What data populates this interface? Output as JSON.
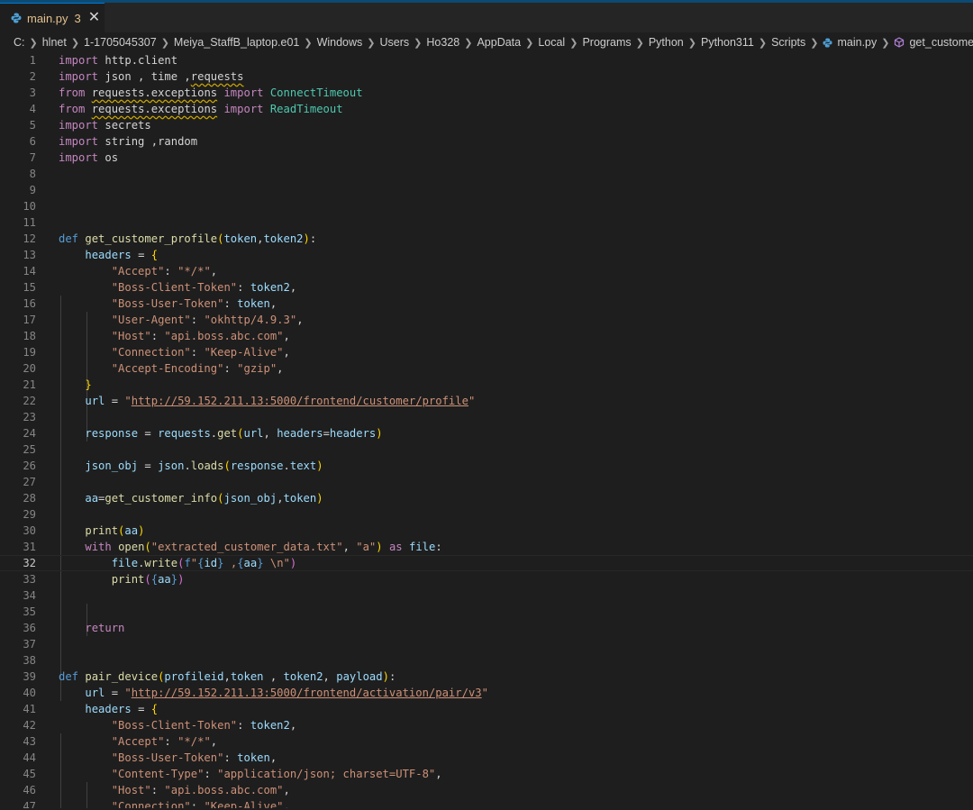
{
  "tab": {
    "filename": "main.py",
    "problems": "3",
    "close": "✕",
    "icon": "python-file-icon"
  },
  "breadcrumb": [
    "C:",
    "hlnet",
    "1-1705045307",
    "Meiya_StaffB_laptop.e01",
    "Windows",
    "Users",
    "Ho328",
    "AppData",
    "Local",
    "Programs",
    "Python",
    "Python311",
    "Scripts"
  ],
  "breadcrumb_file": "main.py",
  "breadcrumb_symbol": "get_customer_profile",
  "colors": {
    "keyword": "#569cd6",
    "control": "#c586c0",
    "function": "#dcdcaa",
    "variable": "#9cdcfe",
    "string": "#ce9178",
    "class": "#4ec9b0",
    "bracket": "#ffd700",
    "warning": "#cca700"
  },
  "editor": {
    "current_line": 32,
    "lines": [
      {
        "n": "1",
        "tokens": [
          [
            "ctl",
            "import"
          ],
          [
            "t",
            " http.client"
          ]
        ]
      },
      {
        "n": "2",
        "tokens": [
          [
            "ctl",
            "import"
          ],
          [
            "t",
            " json , time ,"
          ],
          [
            "sq",
            "requests"
          ]
        ]
      },
      {
        "n": "3",
        "tokens": [
          [
            "ctl",
            "from"
          ],
          [
            "t",
            " "
          ],
          [
            "sq",
            "requests.exceptions"
          ],
          [
            "t",
            " "
          ],
          [
            "ctl",
            "import"
          ],
          [
            "t",
            " "
          ],
          [
            "cls",
            "ConnectTimeout"
          ]
        ]
      },
      {
        "n": "4",
        "tokens": [
          [
            "ctl",
            "from"
          ],
          [
            "t",
            " "
          ],
          [
            "sq",
            "requests.exceptions"
          ],
          [
            "t",
            " "
          ],
          [
            "ctl",
            "import"
          ],
          [
            "t",
            " "
          ],
          [
            "cls",
            "ReadTimeout"
          ]
        ]
      },
      {
        "n": "5",
        "tokens": [
          [
            "ctl",
            "import"
          ],
          [
            "t",
            " secrets"
          ]
        ]
      },
      {
        "n": "6",
        "tokens": [
          [
            "ctl",
            "import"
          ],
          [
            "t",
            " string ,random"
          ]
        ]
      },
      {
        "n": "7",
        "tokens": [
          [
            "ctl",
            "import"
          ],
          [
            "t",
            " os"
          ]
        ]
      },
      {
        "n": "8",
        "tokens": []
      },
      {
        "n": "9",
        "tokens": []
      },
      {
        "n": "10",
        "tokens": []
      },
      {
        "n": "11",
        "tokens": []
      },
      {
        "n": "12",
        "tokens": [
          [
            "kw",
            "def"
          ],
          [
            "t",
            " "
          ],
          [
            "fn",
            "get_customer_profile"
          ],
          [
            "br",
            "("
          ],
          [
            "par",
            "token"
          ],
          [
            "t",
            ","
          ],
          [
            "par",
            "token2"
          ],
          [
            "br",
            ")"
          ],
          [
            "t",
            ":"
          ]
        ]
      },
      {
        "n": "13",
        "tokens": [
          [
            "t",
            "    "
          ],
          [
            "var",
            "headers"
          ],
          [
            "t",
            " = "
          ],
          [
            "br",
            "{"
          ]
        ]
      },
      {
        "n": "14",
        "tokens": [
          [
            "t",
            "        "
          ],
          [
            "str",
            "\"Accept\""
          ],
          [
            "t",
            ": "
          ],
          [
            "str",
            "\"*/*\""
          ],
          [
            "t",
            ","
          ]
        ]
      },
      {
        "n": "15",
        "tokens": [
          [
            "t",
            "        "
          ],
          [
            "str",
            "\"Boss-Client-Token\""
          ],
          [
            "t",
            ": "
          ],
          [
            "var",
            "token2"
          ],
          [
            "t",
            ","
          ]
        ]
      },
      {
        "n": "16",
        "tokens": [
          [
            "t",
            "        "
          ],
          [
            "str",
            "\"Boss-User-Token\""
          ],
          [
            "t",
            ": "
          ],
          [
            "var",
            "token"
          ],
          [
            "t",
            ","
          ]
        ]
      },
      {
        "n": "17",
        "tokens": [
          [
            "t",
            "        "
          ],
          [
            "str",
            "\"User-Agent\""
          ],
          [
            "t",
            ": "
          ],
          [
            "str",
            "\"okhttp/4.9.3\""
          ],
          [
            "t",
            ","
          ]
        ]
      },
      {
        "n": "18",
        "tokens": [
          [
            "t",
            "        "
          ],
          [
            "str",
            "\"Host\""
          ],
          [
            "t",
            ": "
          ],
          [
            "str",
            "\"api.boss.abc.com\""
          ],
          [
            "t",
            ","
          ]
        ]
      },
      {
        "n": "19",
        "tokens": [
          [
            "t",
            "        "
          ],
          [
            "str",
            "\"Connection\""
          ],
          [
            "t",
            ": "
          ],
          [
            "str",
            "\"Keep-Alive\""
          ],
          [
            "t",
            ","
          ]
        ]
      },
      {
        "n": "20",
        "tokens": [
          [
            "t",
            "        "
          ],
          [
            "str",
            "\"Accept-Encoding\""
          ],
          [
            "t",
            ": "
          ],
          [
            "str",
            "\"gzip\""
          ],
          [
            "t",
            ","
          ]
        ]
      },
      {
        "n": "21",
        "tokens": [
          [
            "t",
            "    "
          ],
          [
            "br",
            "}"
          ]
        ]
      },
      {
        "n": "22",
        "tokens": [
          [
            "t",
            "    "
          ],
          [
            "var",
            "url"
          ],
          [
            "t",
            " = "
          ],
          [
            "str",
            "\""
          ],
          [
            "surl",
            "http://59.152.211.13:5000/frontend/customer/profile"
          ],
          [
            "str",
            "\""
          ]
        ]
      },
      {
        "n": "23",
        "tokens": []
      },
      {
        "n": "24",
        "tokens": [
          [
            "t",
            "    "
          ],
          [
            "var",
            "response"
          ],
          [
            "t",
            " = "
          ],
          [
            "var",
            "requests"
          ],
          [
            "t",
            "."
          ],
          [
            "fn",
            "get"
          ],
          [
            "br",
            "("
          ],
          [
            "var",
            "url"
          ],
          [
            "t",
            ", "
          ],
          [
            "par",
            "headers"
          ],
          [
            "t",
            "="
          ],
          [
            "var",
            "headers"
          ],
          [
            "br",
            ")"
          ]
        ]
      },
      {
        "n": "25",
        "tokens": []
      },
      {
        "n": "26",
        "tokens": [
          [
            "t",
            "    "
          ],
          [
            "var",
            "json_obj"
          ],
          [
            "t",
            " = "
          ],
          [
            "var",
            "json"
          ],
          [
            "t",
            "."
          ],
          [
            "fn",
            "loads"
          ],
          [
            "br",
            "("
          ],
          [
            "var",
            "response"
          ],
          [
            "t",
            "."
          ],
          [
            "var",
            "text"
          ],
          [
            "br",
            ")"
          ]
        ]
      },
      {
        "n": "27",
        "tokens": []
      },
      {
        "n": "28",
        "tokens": [
          [
            "t",
            "    "
          ],
          [
            "var",
            "aa"
          ],
          [
            "t",
            "="
          ],
          [
            "fn",
            "get_customer_info"
          ],
          [
            "br",
            "("
          ],
          [
            "var",
            "json_obj"
          ],
          [
            "t",
            ","
          ],
          [
            "var",
            "token"
          ],
          [
            "br",
            ")"
          ]
        ]
      },
      {
        "n": "29",
        "tokens": []
      },
      {
        "n": "30",
        "tokens": [
          [
            "t",
            "    "
          ],
          [
            "fn",
            "print"
          ],
          [
            "br",
            "("
          ],
          [
            "var",
            "aa"
          ],
          [
            "br",
            ")"
          ]
        ]
      },
      {
        "n": "31",
        "tokens": [
          [
            "t",
            "    "
          ],
          [
            "ctl",
            "with"
          ],
          [
            "t",
            " "
          ],
          [
            "fn",
            "open"
          ],
          [
            "br",
            "("
          ],
          [
            "str",
            "\"extracted_customer_data.txt\""
          ],
          [
            "t",
            ", "
          ],
          [
            "str",
            "\"a\""
          ],
          [
            "br",
            ")"
          ],
          [
            "t",
            " "
          ],
          [
            "ctl",
            "as"
          ],
          [
            "t",
            " "
          ],
          [
            "var",
            "file"
          ],
          [
            "t",
            ":"
          ]
        ]
      },
      {
        "n": "32",
        "tokens": [
          [
            "t",
            "        "
          ],
          [
            "var",
            "file"
          ],
          [
            "t",
            "."
          ],
          [
            "fn",
            "write"
          ],
          [
            "br2",
            "("
          ],
          [
            "kw",
            "f"
          ],
          [
            "str",
            "\""
          ],
          [
            "kw",
            "{"
          ],
          [
            "var",
            "id"
          ],
          [
            "kw",
            "}"
          ],
          [
            "str",
            " ,"
          ],
          [
            "kw",
            "{"
          ],
          [
            "var",
            "aa"
          ],
          [
            "kw",
            "}"
          ],
          [
            "str",
            " \\n\""
          ],
          [
            "br2",
            ")"
          ]
        ]
      },
      {
        "n": "33",
        "tokens": [
          [
            "t",
            "        "
          ],
          [
            "fn",
            "print"
          ],
          [
            "br2",
            "("
          ],
          [
            "kw",
            "{"
          ],
          [
            "var",
            "aa"
          ],
          [
            "kw",
            "}"
          ],
          [
            "br2",
            ")"
          ]
        ]
      },
      {
        "n": "34",
        "tokens": []
      },
      {
        "n": "35",
        "tokens": []
      },
      {
        "n": "36",
        "tokens": [
          [
            "t",
            "    "
          ],
          [
            "ctl",
            "return"
          ]
        ]
      },
      {
        "n": "37",
        "tokens": []
      },
      {
        "n": "38",
        "tokens": []
      },
      {
        "n": "39",
        "tokens": [
          [
            "kw",
            "def"
          ],
          [
            "t",
            " "
          ],
          [
            "fn",
            "pair_device"
          ],
          [
            "br",
            "("
          ],
          [
            "par",
            "profileid"
          ],
          [
            "t",
            ","
          ],
          [
            "par",
            "token"
          ],
          [
            "t",
            " , "
          ],
          [
            "par",
            "token2"
          ],
          [
            "t",
            ", "
          ],
          [
            "par",
            "payload"
          ],
          [
            "br",
            ")"
          ],
          [
            "t",
            ":"
          ]
        ]
      },
      {
        "n": "40",
        "tokens": [
          [
            "t",
            "    "
          ],
          [
            "var",
            "url"
          ],
          [
            "t",
            " = "
          ],
          [
            "str",
            "\""
          ],
          [
            "surl",
            "http://59.152.211.13:5000/frontend/activation/pair/v3"
          ],
          [
            "str",
            "\""
          ]
        ]
      },
      {
        "n": "41",
        "tokens": [
          [
            "t",
            "    "
          ],
          [
            "var",
            "headers"
          ],
          [
            "t",
            " = "
          ],
          [
            "br",
            "{"
          ]
        ]
      },
      {
        "n": "42",
        "tokens": [
          [
            "t",
            "        "
          ],
          [
            "str",
            "\"Boss-Client-Token\""
          ],
          [
            "t",
            ": "
          ],
          [
            "var",
            "token2"
          ],
          [
            "t",
            ","
          ]
        ]
      },
      {
        "n": "43",
        "tokens": [
          [
            "t",
            "        "
          ],
          [
            "str",
            "\"Accept\""
          ],
          [
            "t",
            ": "
          ],
          [
            "str",
            "\"*/*\""
          ],
          [
            "t",
            ","
          ]
        ]
      },
      {
        "n": "44",
        "tokens": [
          [
            "t",
            "        "
          ],
          [
            "str",
            "\"Boss-User-Token\""
          ],
          [
            "t",
            ": "
          ],
          [
            "var",
            "token"
          ],
          [
            "t",
            ","
          ]
        ]
      },
      {
        "n": "45",
        "tokens": [
          [
            "t",
            "        "
          ],
          [
            "str",
            "\"Content-Type\""
          ],
          [
            "t",
            ": "
          ],
          [
            "str",
            "\"application/json; charset=UTF-8\""
          ],
          [
            "t",
            ","
          ]
        ]
      },
      {
        "n": "46",
        "tokens": [
          [
            "t",
            "        "
          ],
          [
            "str",
            "\"Host\""
          ],
          [
            "t",
            ": "
          ],
          [
            "str",
            "\"api.boss.abc.com\""
          ],
          [
            "t",
            ","
          ]
        ]
      },
      {
        "n": "47",
        "tokens": [
          [
            "t",
            "        "
          ],
          [
            "str",
            "\"Connection\""
          ],
          [
            "t",
            ": "
          ],
          [
            "str",
            "\"Keep-Alive\""
          ],
          [
            "t",
            ","
          ]
        ]
      }
    ]
  }
}
